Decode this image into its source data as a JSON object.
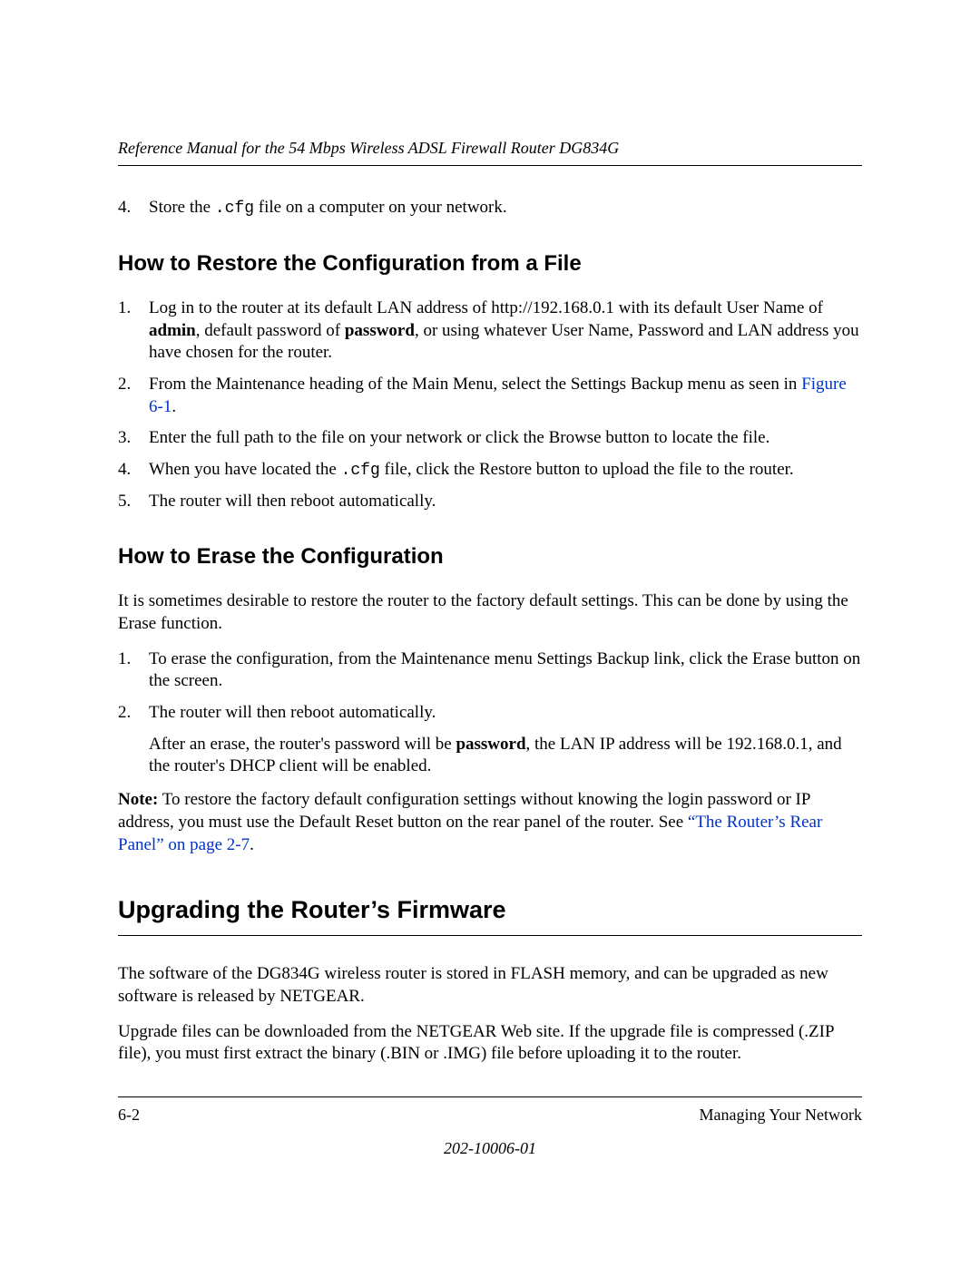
{
  "header": {
    "running_title": "Reference Manual for the 54 Mbps Wireless ADSL Firewall Router DG834G"
  },
  "first_list": {
    "item4_num": "4.",
    "item4_a": "Store the ",
    "item4_code": ".cfg",
    "item4_b": " file on a computer on your network."
  },
  "h_restore": "How to Restore the Configuration from a File",
  "restore_list": {
    "n1": "1.",
    "t1a": "Log in to the router at its default LAN address of http://192.168.0.1 with its default User Name of ",
    "t1_admin": "admin",
    "t1b": ", default password of ",
    "t1_pw": "password",
    "t1c": ", or using whatever User Name, Password and LAN address you have chosen for the router.",
    "n2": "2.",
    "t2a": "From the Maintenance heading of the Main Menu, select the Settings Backup menu as seen in ",
    "t2_link": "Figure 6-1",
    "t2b": ".",
    "n3": "3.",
    "t3": "Enter the full path to the file on your network or click the Browse button to locate the file.",
    "n4": "4.",
    "t4a": "When you have located the ",
    "t4_code": ".cfg",
    "t4b": " file, click the Restore button to upload the file to the router.",
    "n5": "5.",
    "t5": "The router will then reboot automatically."
  },
  "h_erase": "How to Erase the Configuration",
  "erase_intro": "It is sometimes desirable to restore the router to the factory default settings. This can be done by using the Erase function.",
  "erase_list": {
    "n1": "1.",
    "t1": "To erase the configuration, from the Maintenance menu Settings Backup link, click the Erase button on the screen.",
    "n2": "2.",
    "t2": "The router will then reboot automatically.",
    "after_a": "After an erase, the router's password will be ",
    "after_pw": "password",
    "after_b": ", the LAN IP address will be 192.168.0.1, and the router's DHCP client will be enabled."
  },
  "note": {
    "label": "Note:",
    "a": " To restore the factory default configuration settings without knowing the login password or IP address, you must use the Default Reset button on the rear panel of the router. See ",
    "link": "“The Router’s Rear Panel” on page 2-7",
    "b": "."
  },
  "h_upgrade": "Upgrading the Router’s Firmware",
  "upgrade_p1": "The software of the DG834G wireless router is stored in FLASH memory, and can be upgraded as new software is released by NETGEAR.",
  "upgrade_p2": "Upgrade files can be downloaded from the NETGEAR Web site. If the upgrade file is compressed (.ZIP file), you must first extract the binary (.BIN or .IMG) file before uploading it to the router.",
  "footer": {
    "page": "6-2",
    "section": "Managing Your Network",
    "docnum": "202-10006-01"
  }
}
